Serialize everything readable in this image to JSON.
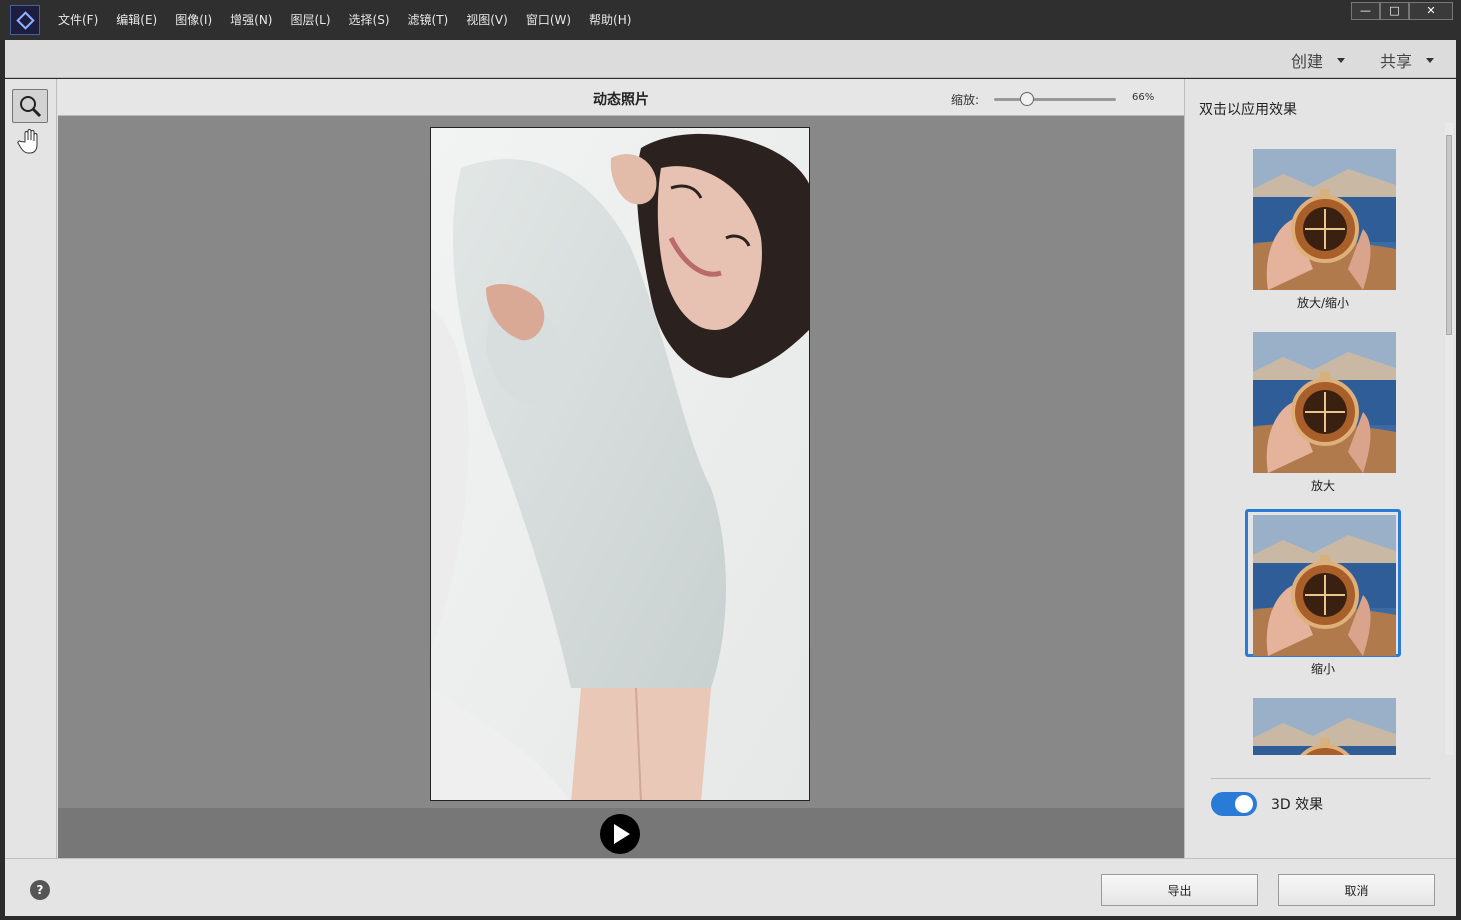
{
  "menu": {
    "items": [
      "文件(F)",
      "编辑(E)",
      "图像(I)",
      "增强(N)",
      "图层(L)",
      "选择(S)",
      "滤镜(T)",
      "视图(V)",
      "窗口(W)",
      "帮助(H)"
    ]
  },
  "window_controls": {
    "minimize": "—",
    "maximize": "□",
    "close": "✕"
  },
  "topbar": {
    "create_label": "创建",
    "share_label": "共享"
  },
  "canvas": {
    "title": "动态照片",
    "zoom_label": "缩放:",
    "zoom_value": "66%",
    "zoom_fraction": 0.27
  },
  "panel": {
    "heading": "双击以应用效果",
    "effects": [
      {
        "label": "放大/缩小",
        "selected": false
      },
      {
        "label": "放大",
        "selected": false
      },
      {
        "label": "缩小",
        "selected": true
      },
      {
        "label": "",
        "selected": false
      }
    ],
    "toggle_label": "3D 效果",
    "toggle_on": true
  },
  "bottom": {
    "help": "?",
    "export_label": "导出",
    "cancel_label": "取消"
  },
  "colors": {
    "accent": "#2a7bd8",
    "canvas_bg": "#888888",
    "titlebar_bg": "#2f2f2f"
  },
  "icons": {
    "zoom_tool": "magnifier-icon",
    "hand_tool": "hand-icon",
    "play": "play-icon",
    "help": "question-icon"
  }
}
